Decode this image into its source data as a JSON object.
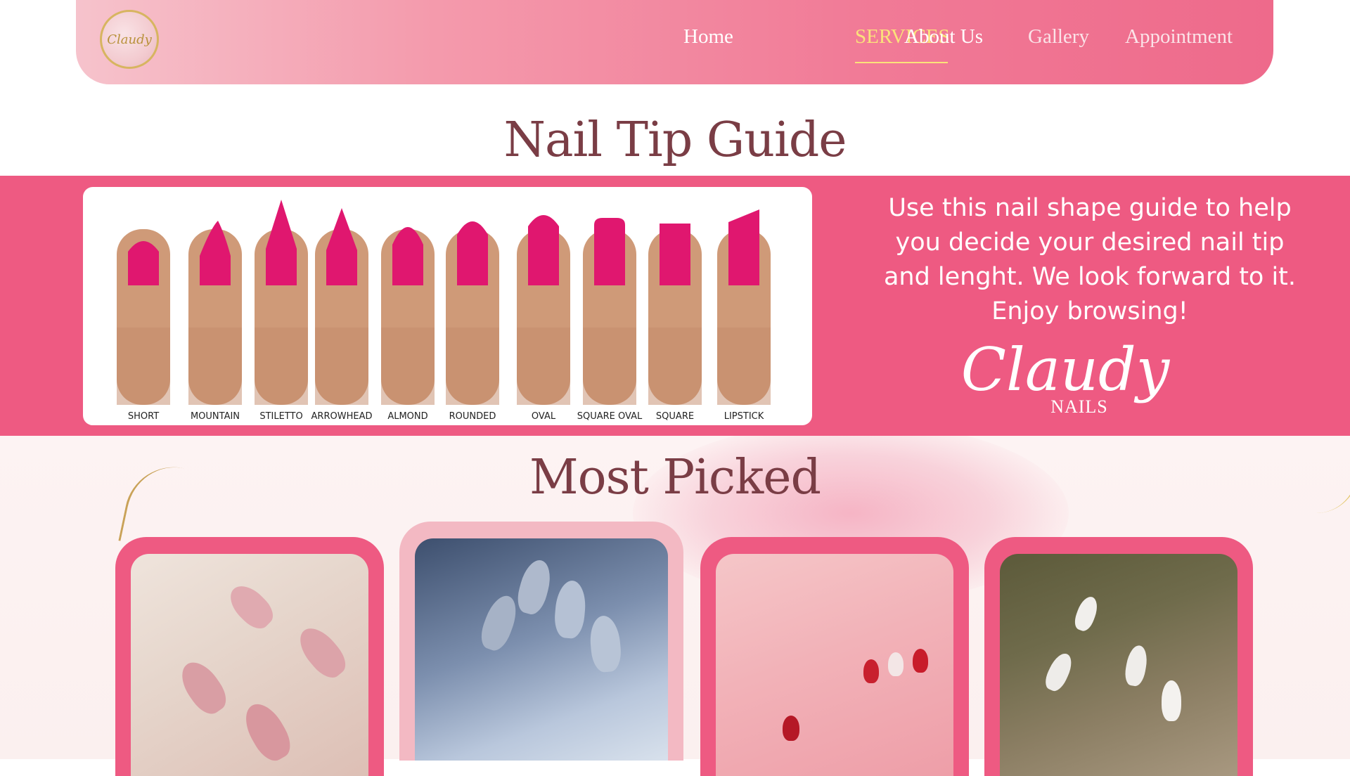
{
  "header": {
    "logo_text": "Claudy",
    "nav": [
      {
        "label": "Home",
        "active": false
      },
      {
        "label": "SERVICES",
        "active": true
      },
      {
        "label": "About Us",
        "active": false
      },
      {
        "label": "Gallery",
        "active": false
      },
      {
        "label": "Appointment",
        "active": false
      }
    ]
  },
  "guide": {
    "title": "Nail Tip Guide",
    "shapes": [
      "SHORT",
      "MOUNTAIN",
      "STILETTO",
      "ARROWHEAD",
      "ALMOND",
      "ROUNDED",
      "OVAL",
      "SQUARE OVAL",
      "SQUARE",
      "LIPSTICK"
    ],
    "description": "Use this nail shape guide to help you decide  your desired nail tip and lenght. We look forward to it. Enjoy browsing!",
    "brand_name": "Claudy",
    "brand_sub": "NAILS"
  },
  "most_picked": {
    "title": "Most Picked",
    "cards": [
      {
        "name": "nude-almond"
      },
      {
        "name": "chrome-blue-almond"
      },
      {
        "name": "red-glitter"
      },
      {
        "name": "white-coffin"
      }
    ]
  },
  "colors": {
    "accent_pink": "#ee5a82",
    "nail_magenta": "#e0176f",
    "title_brown": "#7a3d45",
    "nav_active": "#fbe27a"
  }
}
